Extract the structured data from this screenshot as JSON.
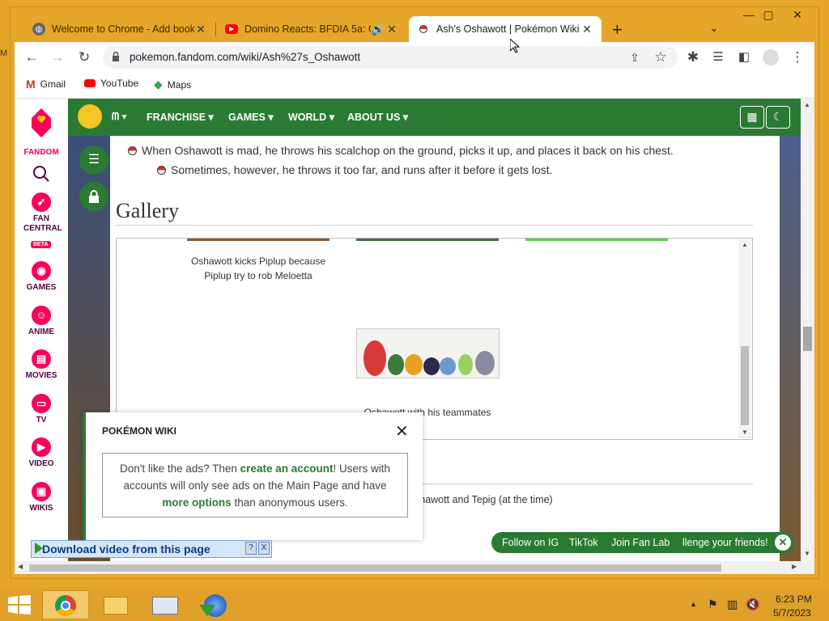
{
  "tabs": [
    {
      "title": "Welcome to Chrome - Add book",
      "favicon": "chrome-globe-icon"
    },
    {
      "title": "Domino Reacts: BFDIA 5a: Ge",
      "favicon": "youtube-icon",
      "audio": true
    },
    {
      "title": "Ash's Oshawott | Pokémon Wiki |",
      "favicon": "pokeball-icon",
      "active": true
    }
  ],
  "new_tab_symbol": "+",
  "url": "pokemon.fandom.com/wiki/Ash%27s_Oshawott",
  "bookmarks": [
    {
      "label": "Gmail",
      "icon": "gmail-icon"
    },
    {
      "label": "YouTube",
      "icon": "youtube-icon"
    },
    {
      "label": "Maps",
      "icon": "maps-icon"
    }
  ],
  "side_label": "M",
  "rail": {
    "brand": "FANDOM",
    "items": [
      {
        "label": "FAN CENTRAL",
        "badge": "BETA",
        "icon": "rocket-icon"
      },
      {
        "label": "GAMES",
        "icon": "gamepad-icon"
      },
      {
        "label": "ANIME",
        "icon": "anime-icon"
      },
      {
        "label": "MOVIES",
        "icon": "movies-icon"
      },
      {
        "label": "TV",
        "icon": "tv-icon"
      },
      {
        "label": "VIDEO",
        "icon": "video-icon"
      },
      {
        "label": "WIKIS",
        "icon": "wikis-icon"
      }
    ]
  },
  "nav": {
    "items": [
      "FRANCHISE",
      "GAMES",
      "WORLD",
      "ABOUT US"
    ]
  },
  "article": {
    "bullet1": "When Oshawott is mad, he throws his scalchop on the ground, picks it up, and places it back on his chest.",
    "bullet2": "Sometimes, however, he throws it too far, and runs after it before it gets lost.",
    "gallery_heading": "Gallery",
    "caption1": "Oshawott kicks Piplup because Piplup try to rob Meloetta",
    "caption2": "Oshawott with his teammates",
    "lower_text": "shawott and Tepig (at the time)"
  },
  "popup": {
    "title": "POKÉMON WIKI",
    "msg_pre": "Don't like the ads? Then ",
    "msg_link1": "create an account",
    "msg_mid": "! Users with accounts will only see ads on the Main Page and have ",
    "msg_link2": "more options",
    "msg_post": " than anonymous users."
  },
  "social": [
    "Follow on IG",
    "TikTok",
    "Join Fan Lab",
    "llenge your friends!"
  ],
  "download_bar": {
    "label": "Download video from this page",
    "help": "?",
    "close": "X"
  },
  "taskbar": {
    "time": "6:23 PM",
    "date": "5/7/2023"
  },
  "colors": {
    "fandom_pink": "#fa005a",
    "wiki_green": "#2b7a33",
    "os_accent": "#e6a629"
  }
}
